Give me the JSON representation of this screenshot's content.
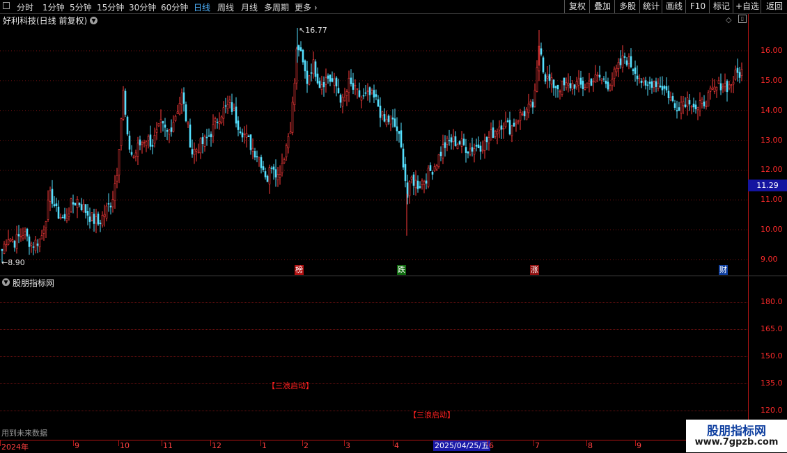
{
  "toolbar": {
    "timeframes": [
      "分时",
      "1分钟",
      "5分钟",
      "15分钟",
      "30分钟",
      "60分钟",
      "日线",
      "周线",
      "月线",
      "多周期",
      "更多"
    ],
    "active_timeframe": "日线",
    "right_buttons": [
      "复权",
      "叠加",
      "多股",
      "统计",
      "画线",
      "F10",
      "标记",
      "+自选",
      "返回"
    ]
  },
  "chart_header": {
    "title": "好利科技(日线 前复权)"
  },
  "indicator_header": {
    "title": "股朋指标网"
  },
  "price_axis": {
    "labels": [
      "16.00",
      "15.00",
      "14.00",
      "13.00",
      "12.00",
      "11.00",
      "10.00",
      "9.00"
    ],
    "current_price": "11.29"
  },
  "callouts": {
    "high": "16.77",
    "low": "8.90"
  },
  "event_markers": [
    {
      "text": "榜",
      "color": "#c01010"
    },
    {
      "text": "跌",
      "color": "#107010"
    },
    {
      "text": "涨",
      "color": "#a01010"
    },
    {
      "text": "财",
      "color": "#1040a0"
    }
  ],
  "indicator_axis": {
    "labels": [
      "180.0",
      "165.0",
      "150.0",
      "135.0",
      "120.0"
    ]
  },
  "signals": [
    "【三浪启动】",
    "【三浪启动】"
  ],
  "date_axis": {
    "labels": [
      "2024年",
      "9",
      "10",
      "11",
      "12",
      "1",
      "2",
      "3",
      "4",
      "6",
      "7",
      "8",
      "9"
    ],
    "current_date": "2025/04/25/五"
  },
  "footnote": "用到未来数据",
  "watermark": {
    "brand": "股朋指标网",
    "url": "www.7gpzb.com"
  },
  "chart_data": {
    "type": "candlestick",
    "title": "好利科技(日线 前复权)",
    "y_range": [
      8.6,
      17.0
    ],
    "price_high": 16.77,
    "price_low": 8.9,
    "current_price": 11.29,
    "close_path": [
      {
        "x": 2,
        "y": 9.3
      },
      {
        "x": 10,
        "y": 9.8
      },
      {
        "x": 20,
        "y": 9.6
      },
      {
        "x": 32,
        "y": 9.9
      },
      {
        "x": 45,
        "y": 9.5
      },
      {
        "x": 58,
        "y": 9.7
      },
      {
        "x": 68,
        "y": 10.8
      },
      {
        "x": 72,
        "y": 11.2
      },
      {
        "x": 80,
        "y": 10.6
      },
      {
        "x": 92,
        "y": 10.3
      },
      {
        "x": 100,
        "y": 10.8
      },
      {
        "x": 110,
        "y": 11.0
      },
      {
        "x": 120,
        "y": 10.7
      },
      {
        "x": 130,
        "y": 10.4
      },
      {
        "x": 140,
        "y": 10.2
      },
      {
        "x": 150,
        "y": 10.6
      },
      {
        "x": 160,
        "y": 11.0
      },
      {
        "x": 167,
        "y": 12.0
      },
      {
        "x": 171,
        "y": 13.2
      },
      {
        "x": 176,
        "y": 14.6
      },
      {
        "x": 182,
        "y": 13.0
      },
      {
        "x": 190,
        "y": 12.4
      },
      {
        "x": 198,
        "y": 12.8
      },
      {
        "x": 208,
        "y": 13.1
      },
      {
        "x": 218,
        "y": 12.9
      },
      {
        "x": 230,
        "y": 13.5
      },
      {
        "x": 240,
        "y": 13.2
      },
      {
        "x": 250,
        "y": 13.8
      },
      {
        "x": 260,
        "y": 14.5
      },
      {
        "x": 268,
        "y": 13.5
      },
      {
        "x": 275,
        "y": 12.6
      },
      {
        "x": 285,
        "y": 12.8
      },
      {
        "x": 295,
        "y": 13.0
      },
      {
        "x": 305,
        "y": 13.4
      },
      {
        "x": 315,
        "y": 13.9
      },
      {
        "x": 330,
        "y": 14.2
      },
      {
        "x": 340,
        "y": 13.6
      },
      {
        "x": 350,
        "y": 13.2
      },
      {
        "x": 360,
        "y": 12.8
      },
      {
        "x": 372,
        "y": 12.4
      },
      {
        "x": 383,
        "y": 11.7
      },
      {
        "x": 390,
        "y": 12.3
      },
      {
        "x": 398,
        "y": 11.8
      },
      {
        "x": 408,
        "y": 12.6
      },
      {
        "x": 416,
        "y": 13.5
      },
      {
        "x": 421,
        "y": 14.6
      },
      {
        "x": 426,
        "y": 16.3
      },
      {
        "x": 432,
        "y": 15.7
      },
      {
        "x": 440,
        "y": 15.0
      },
      {
        "x": 448,
        "y": 15.6
      },
      {
        "x": 458,
        "y": 14.9
      },
      {
        "x": 470,
        "y": 15.1
      },
      {
        "x": 482,
        "y": 14.8
      },
      {
        "x": 492,
        "y": 14.2
      },
      {
        "x": 500,
        "y": 14.9
      },
      {
        "x": 510,
        "y": 14.6
      },
      {
        "x": 520,
        "y": 14.4
      },
      {
        "x": 530,
        "y": 14.5
      },
      {
        "x": 540,
        "y": 14.3
      },
      {
        "x": 550,
        "y": 13.6
      },
      {
        "x": 560,
        "y": 13.7
      },
      {
        "x": 570,
        "y": 13.3
      },
      {
        "x": 578,
        "y": 12.3
      },
      {
        "x": 584,
        "y": 11.1
      },
      {
        "x": 590,
        "y": 11.7
      },
      {
        "x": 600,
        "y": 11.5
      },
      {
        "x": 612,
        "y": 11.8
      },
      {
        "x": 624,
        "y": 12.2
      },
      {
        "x": 636,
        "y": 12.8
      },
      {
        "x": 648,
        "y": 13.0
      },
      {
        "x": 660,
        "y": 12.9
      },
      {
        "x": 672,
        "y": 12.7
      },
      {
        "x": 684,
        "y": 12.8
      },
      {
        "x": 696,
        "y": 12.9
      },
      {
        "x": 708,
        "y": 13.3
      },
      {
        "x": 720,
        "y": 13.6
      },
      {
        "x": 732,
        "y": 13.4
      },
      {
        "x": 744,
        "y": 13.8
      },
      {
        "x": 756,
        "y": 14.0
      },
      {
        "x": 766,
        "y": 14.2
      },
      {
        "x": 770,
        "y": 15.3
      },
      {
        "x": 774,
        "y": 16.5
      },
      {
        "x": 780,
        "y": 15.2
      },
      {
        "x": 790,
        "y": 14.9
      },
      {
        "x": 800,
        "y": 14.8
      },
      {
        "x": 812,
        "y": 14.8
      },
      {
        "x": 824,
        "y": 14.9
      },
      {
        "x": 836,
        "y": 14.8
      },
      {
        "x": 848,
        "y": 15.0
      },
      {
        "x": 860,
        "y": 15.1
      },
      {
        "x": 872,
        "y": 14.9
      },
      {
        "x": 884,
        "y": 15.3
      },
      {
        "x": 896,
        "y": 15.8
      },
      {
        "x": 906,
        "y": 15.5
      },
      {
        "x": 916,
        "y": 15.2
      },
      {
        "x": 926,
        "y": 14.7
      },
      {
        "x": 936,
        "y": 15.0
      },
      {
        "x": 946,
        "y": 14.9
      },
      {
        "x": 958,
        "y": 14.6
      },
      {
        "x": 968,
        "y": 14.1
      },
      {
        "x": 978,
        "y": 14.3
      },
      {
        "x": 990,
        "y": 14.4
      },
      {
        "x": 1000,
        "y": 14.0
      },
      {
        "x": 1010,
        "y": 14.3
      },
      {
        "x": 1022,
        "y": 14.6
      },
      {
        "x": 1034,
        "y": 14.9
      },
      {
        "x": 1046,
        "y": 14.8
      },
      {
        "x": 1056,
        "y": 15.2
      },
      {
        "x": 1064,
        "y": 15.3
      }
    ]
  }
}
